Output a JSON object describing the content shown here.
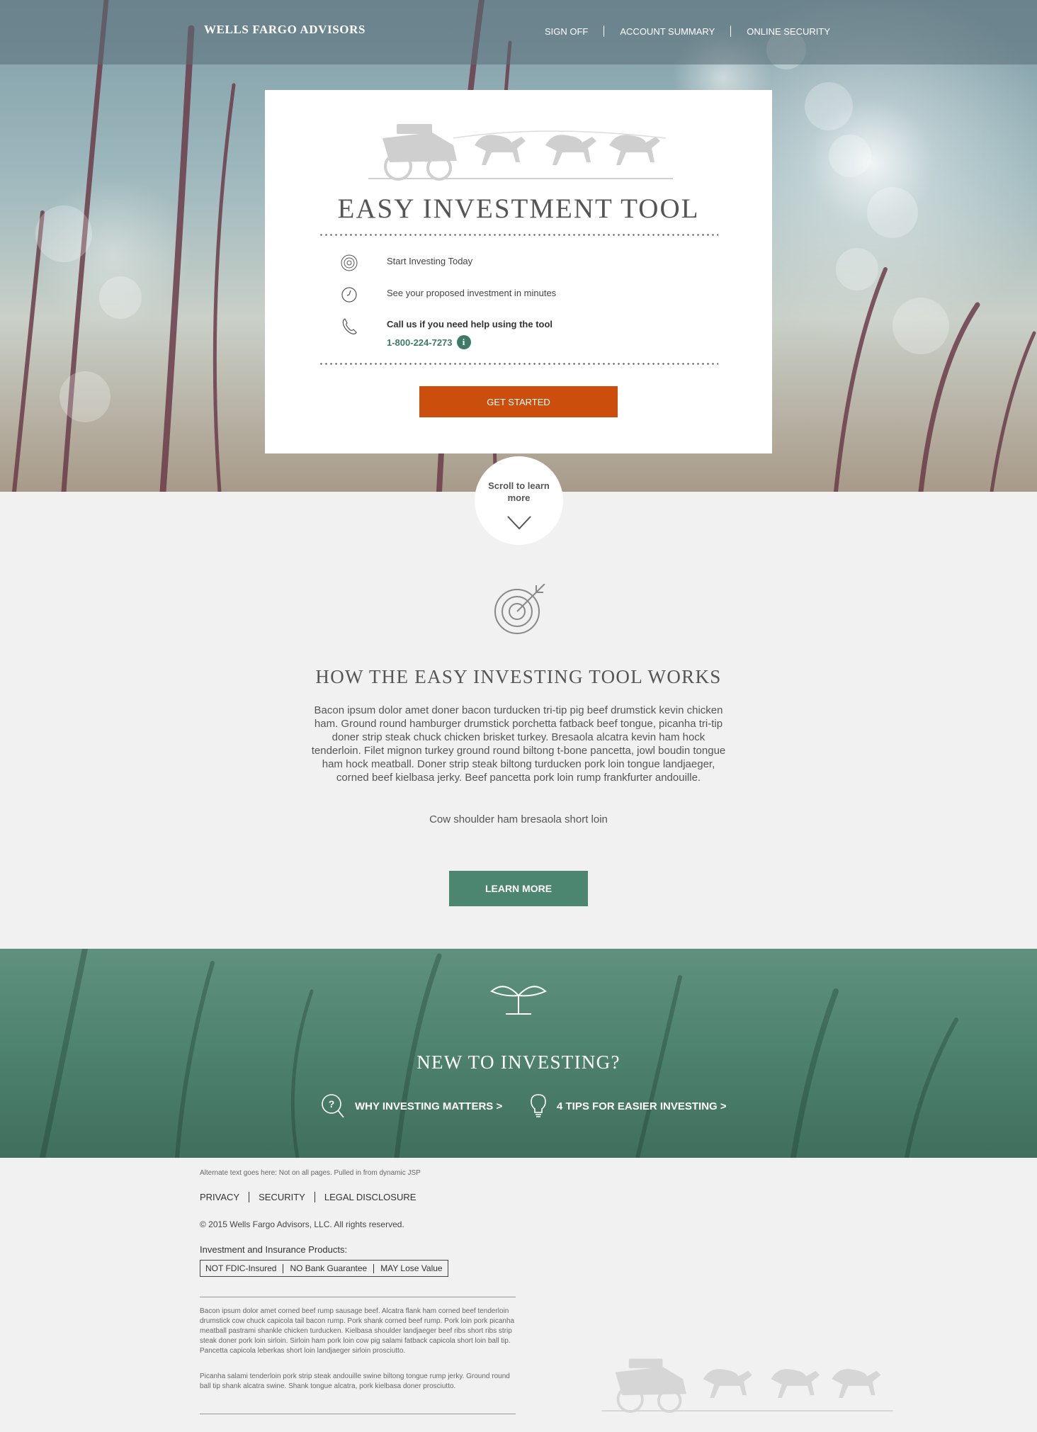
{
  "header": {
    "logo": "WELLS FARGO ADVISORS",
    "nav": [
      "SIGN OFF",
      "ACCOUNT SUMMARY",
      "ONLINE SECURITY"
    ]
  },
  "card": {
    "title": "EASY INVESTMENT TOOL",
    "features": [
      {
        "icon": "target-icon",
        "text": "Start Investing Today"
      },
      {
        "icon": "clock-icon",
        "text": "See your proposed investment in minutes"
      }
    ],
    "call": {
      "icon": "phone-icon",
      "text": "Call us if you need help using the tool",
      "phone": "1-800-224-7273",
      "info_glyph": "i"
    },
    "cta": "GET STARTED"
  },
  "scroll": {
    "text": "Scroll to learn more"
  },
  "how": {
    "title": "HOW THE EASY INVESTING TOOL WORKS",
    "body": "Bacon ipsum dolor amet doner bacon turducken tri-tip pig beef drumstick kevin chicken ham. Ground round hamburger drumstick porchetta fatback beef tongue, picanha tri-tip doner strip steak chuck chicken brisket turkey. Bresaola alcatra kevin ham hock tenderloin. Filet mignon turkey ground round biltong t-bone pancetta, jowl boudin tongue ham hock meatball. Doner strip steak biltong turducken pork loin tongue landjaeger, corned beef kielbasa jerky. Beef pancetta pork loin rump frankfurter andouille.",
    "subtitle": "Cow shoulder ham bresaola short loin",
    "cta": "LEARN MORE"
  },
  "new_investing": {
    "title": "NEW TO INVESTING?",
    "links": [
      {
        "icon": "question-search-icon",
        "label": "WHY INVESTING MATTERS  >"
      },
      {
        "icon": "lightbulb-icon",
        "label": "4 TIPS FOR EASIER INVESTING  >"
      }
    ]
  },
  "footer": {
    "alt_text": "Alternate text goes here: Not on all pages. Pulled in from dynamic JSP",
    "links": [
      "PRIVACY",
      "SECURITY",
      "LEGAL DISCLOSURE"
    ],
    "copyright": "© 2015 Wells Fargo Advisors, LLC. All rights reserved.",
    "ins_label": "Investment and Insurance Products:",
    "ins_items": [
      "NOT FDIC-Insured",
      "NO Bank Guarantee",
      "MAY Lose Value"
    ],
    "fine1": "Bacon ipsum dolor amet corned beef rump sausage beef. Alcatra flank ham corned beef tenderloin drumstick cow chuck capicola tail bacon rump. Pork shank corned beef rump. Pork loin pork picanha meatball pastrami shankle chicken turducken. Kielbasa shoulder landjaeger beef ribs short ribs strip steak doner pork loin sirloin. Sirloin ham pork loin cow pig salami fatback capicola short loin ball tip. Pancetta capicola leberkas short loin landjaeger sirloin prosciutto.",
    "fine2": "Picanha salami tenderloin pork strip steak andouille swine biltong tongue rump jerky. Ground round ball tip shank alcatra swine. Shank tongue alcatra, pork kielbasa doner prosciutto."
  }
}
